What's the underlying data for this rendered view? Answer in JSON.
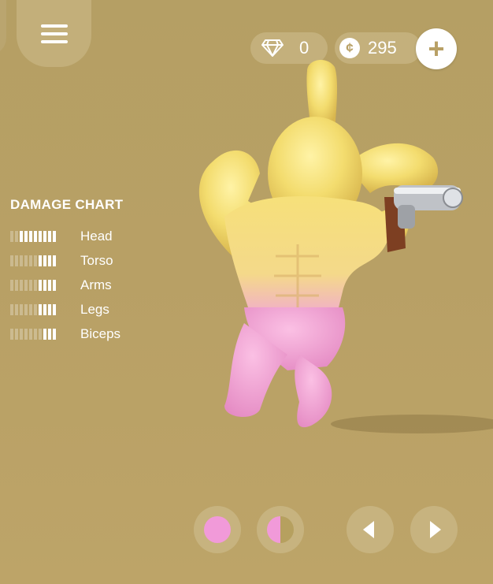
{
  "hud": {
    "gems": "0",
    "coins": "295",
    "coin_symbol": "¢",
    "add_label": "+"
  },
  "damage_chart": {
    "title": "DAMAGE CHART",
    "rows": [
      {
        "label": "Head",
        "level": 8,
        "max": 10
      },
      {
        "label": "Torso",
        "level": 4,
        "max": 10
      },
      {
        "label": "Arms",
        "level": 4,
        "max": 10
      },
      {
        "label": "Legs",
        "level": 4,
        "max": 10
      },
      {
        "label": "Biceps",
        "level": 3,
        "max": 10
      }
    ]
  },
  "character_colors": {
    "body": "#f4df70",
    "pants": "#f0a1cf",
    "background": "#b8a065"
  },
  "bottom_controls": [
    "pink-color-swatch",
    "split-color-swatch",
    "previous-arrow",
    "next-arrow"
  ]
}
